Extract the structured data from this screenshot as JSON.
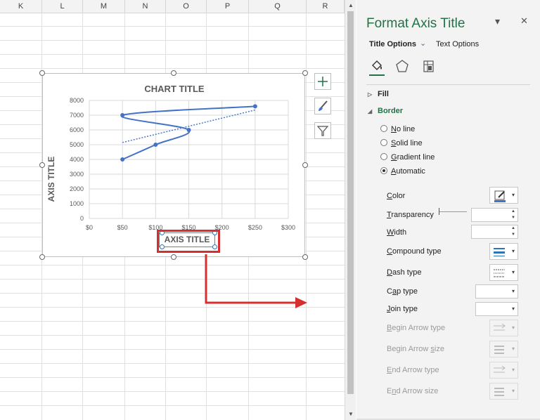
{
  "columns": [
    "K",
    "L",
    "M",
    "N",
    "O",
    "P",
    "Q",
    "R"
  ],
  "chart": {
    "title": "CHART TITLE",
    "y_axis_title": "AXIS TITLE",
    "x_axis_title": "AXIS TITLE",
    "y_ticks": [
      "8000",
      "7000",
      "6000",
      "5000",
      "4000",
      "3000",
      "2000",
      "1000",
      "0"
    ],
    "x_ticks": [
      "$0",
      "$50",
      "$100",
      "$150",
      "$200",
      "$250",
      "$300"
    ],
    "line_color": "#4472c4",
    "highlight_color": "#d62f2f"
  },
  "chart_data": {
    "type": "scatter",
    "title": "CHART TITLE",
    "xlabel": "AXIS TITLE",
    "ylabel": "AXIS TITLE",
    "xlim": [
      0,
      300
    ],
    "ylim": [
      0,
      8000
    ],
    "series": [
      {
        "x": [
          50,
          100,
          150,
          50,
          250
        ],
        "y": [
          4000,
          5000,
          6000,
          7000,
          7600
        ]
      }
    ],
    "trendline": {
      "style": "dotted",
      "from": [
        50,
        5150
      ],
      "to": [
        250,
        7350
      ]
    },
    "grid": true,
    "legend": "none"
  },
  "side_buttons": [
    "chart-elements-icon",
    "chart-styles-icon",
    "chart-filters-icon"
  ],
  "pane": {
    "title": "Format Axis Title",
    "dropdown_glyph": "▾",
    "close_glyph": "✕",
    "tabs": {
      "title_options": "Title Options",
      "text_options": "Text Options"
    },
    "icons": [
      "fill-line-icon",
      "effects-icon",
      "size-properties-icon"
    ],
    "sections": {
      "fill": "Fill",
      "border": "Border"
    },
    "border_radios": [
      {
        "label": "No line",
        "ul": "N",
        "rest": "o line",
        "selected": false
      },
      {
        "label": "Solid line",
        "ul": "S",
        "rest": "olid line",
        "selected": false
      },
      {
        "label": "Gradient line",
        "ul": "G",
        "rest": "radient line",
        "selected": false
      },
      {
        "label": "Automatic",
        "ul": "A",
        "rest": "utomatic",
        "selected": true
      }
    ],
    "props": {
      "color": {
        "ul": "C",
        "rest": "olor"
      },
      "transparency": {
        "ul": "T",
        "rest": "ransparency"
      },
      "width": {
        "ul": "W",
        "rest": "idth"
      },
      "compound_type": {
        "ul": "C",
        "rest": "ompound type"
      },
      "dash_type": {
        "ul": "D",
        "rest": "ash type"
      },
      "cap_type": {
        "pre": "C",
        "ul": "a",
        "rest": "p type"
      },
      "join_type": {
        "ul": "J",
        "rest": "oin type"
      },
      "begin_arrow_type": {
        "ul": "B",
        "rest": "egin Arrow type"
      },
      "begin_arrow_size": {
        "pre": "Begin Arrow ",
        "ul": "s",
        "rest": "ize"
      },
      "end_arrow_type": {
        "ul": "E",
        "rest": "nd Arrow type"
      },
      "end_arrow_size": {
        "pre": "E",
        "ul": "n",
        "rest": "d Arrow size"
      }
    }
  },
  "colors": {
    "accent": "#217346",
    "pane_bg": "#f3f3f3"
  }
}
